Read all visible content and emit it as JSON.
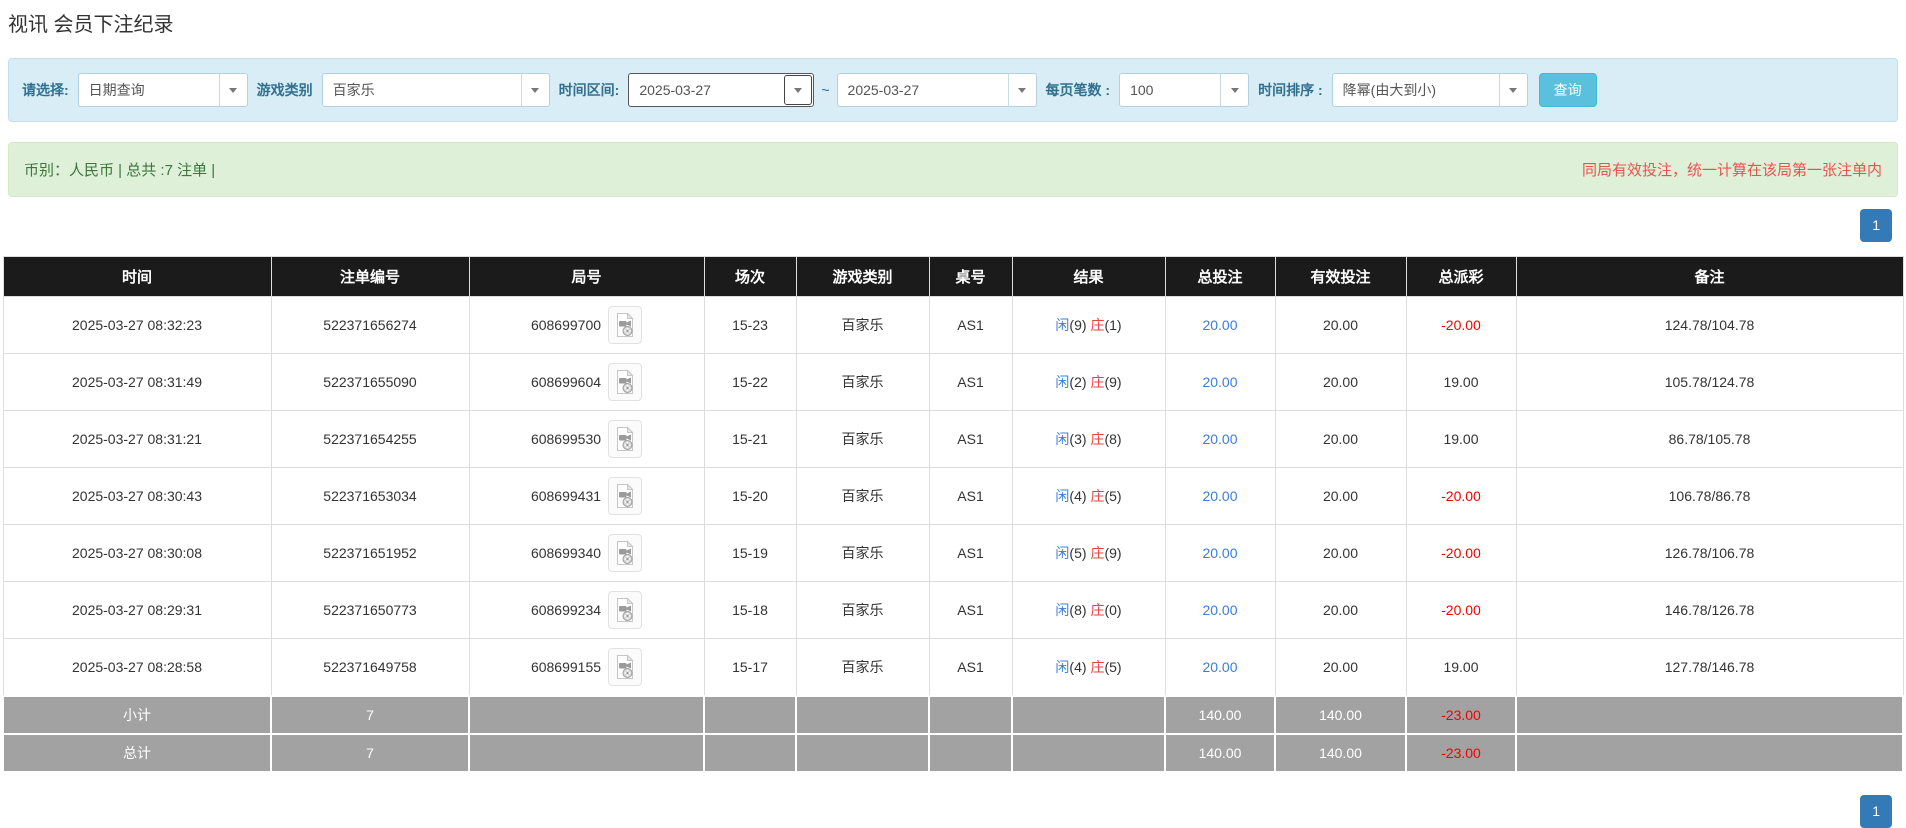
{
  "page": {
    "title": "视讯 会员下注纪录"
  },
  "colors": {
    "filter_bg": "#d9edf7",
    "filter_label": "#31708f",
    "search_button_bg": "#5bc0de",
    "info_bg": "#dff0d8",
    "info_text_green": "#3c763d",
    "note_text_red": "#e9534f",
    "pagination_blue": "#337ab7",
    "table_header_bg": "#1b1b1b",
    "summary_row_gray": "#a2a2a2",
    "link_blue": "#3c7dd9",
    "banker_red": "#e8423c",
    "negative_red": "#f50000"
  },
  "filter": {
    "query_type": {
      "label": "请选择:",
      "value": "日期查询"
    },
    "game_type": {
      "label": "游戏类别",
      "value": "百家乐"
    },
    "date_range": {
      "label": "时间区间:",
      "from": "2025-03-27",
      "separator": "~",
      "to": "2025-03-27"
    },
    "page_size": {
      "label": "每页笔数 :",
      "value": "100"
    },
    "time_sort": {
      "label": "时间排序 :",
      "value": "降幂(由大到小)"
    },
    "search_button": "查询"
  },
  "summary_bar": {
    "left": "币别：人民币 | 总共 :7 注单 |",
    "right": "同局有效投注，统一计算在该局第一张注单内"
  },
  "pagination": {
    "current_page": "1"
  },
  "icons": {
    "select_caret": "caret-down-icon",
    "round_video": "video-file-icon"
  },
  "table": {
    "headers": [
      "时间",
      "注单编号",
      "局号",
      "场次",
      "游戏类别",
      "桌号",
      "结果",
      "总投注",
      "有效投注",
      "总派彩",
      "备注"
    ],
    "rows": [
      {
        "time": "2025-03-27 08:32:23",
        "bet_id": "522371656274",
        "round_no": "608699700",
        "session": "15-23",
        "game": "百家乐",
        "table_no": "AS1",
        "player_label": "闲",
        "player_score": "(9)",
        "banker_label": "庄",
        "banker_score": "(1)",
        "total_bet": "20.00",
        "valid_bet": "20.00",
        "payout": "-20.00",
        "remark": "124.78/104.78"
      },
      {
        "time": "2025-03-27 08:31:49",
        "bet_id": "522371655090",
        "round_no": "608699604",
        "session": "15-22",
        "game": "百家乐",
        "table_no": "AS1",
        "player_label": "闲",
        "player_score": "(2)",
        "banker_label": "庄",
        "banker_score": "(9)",
        "total_bet": "20.00",
        "valid_bet": "20.00",
        "payout": "19.00",
        "remark": "105.78/124.78"
      },
      {
        "time": "2025-03-27 08:31:21",
        "bet_id": "522371654255",
        "round_no": "608699530",
        "session": "15-21",
        "game": "百家乐",
        "table_no": "AS1",
        "player_label": "闲",
        "player_score": "(3)",
        "banker_label": "庄",
        "banker_score": "(8)",
        "total_bet": "20.00",
        "valid_bet": "20.00",
        "payout": "19.00",
        "remark": "86.78/105.78"
      },
      {
        "time": "2025-03-27 08:30:43",
        "bet_id": "522371653034",
        "round_no": "608699431",
        "session": "15-20",
        "game": "百家乐",
        "table_no": "AS1",
        "player_label": "闲",
        "player_score": "(4)",
        "banker_label": "庄",
        "banker_score": "(5)",
        "total_bet": "20.00",
        "valid_bet": "20.00",
        "payout": "-20.00",
        "remark": "106.78/86.78"
      },
      {
        "time": "2025-03-27 08:30:08",
        "bet_id": "522371651952",
        "round_no": "608699340",
        "session": "15-19",
        "game": "百家乐",
        "table_no": "AS1",
        "player_label": "闲",
        "player_score": "(5)",
        "banker_label": "庄",
        "banker_score": "(9)",
        "total_bet": "20.00",
        "valid_bet": "20.00",
        "payout": "-20.00",
        "remark": "126.78/106.78"
      },
      {
        "time": "2025-03-27 08:29:31",
        "bet_id": "522371650773",
        "round_no": "608699234",
        "session": "15-18",
        "game": "百家乐",
        "table_no": "AS1",
        "player_label": "闲",
        "player_score": "(8)",
        "banker_label": "庄",
        "banker_score": "(0)",
        "total_bet": "20.00",
        "valid_bet": "20.00",
        "payout": "-20.00",
        "remark": "146.78/126.78"
      },
      {
        "time": "2025-03-27 08:28:58",
        "bet_id": "522371649758",
        "round_no": "608699155",
        "session": "15-17",
        "game": "百家乐",
        "table_no": "AS1",
        "player_label": "闲",
        "player_score": "(4)",
        "banker_label": "庄",
        "banker_score": "(5)",
        "total_bet": "20.00",
        "valid_bet": "20.00",
        "payout": "19.00",
        "remark": "127.78/146.78"
      }
    ],
    "subtotal_row": {
      "label": "小计",
      "count": "7",
      "total_bet": "140.00",
      "valid_bet": "140.00",
      "payout": "-23.00"
    },
    "total_row": {
      "label": "总计",
      "count": "7",
      "total_bet": "140.00",
      "valid_bet": "140.00",
      "payout": "-23.00"
    }
  }
}
